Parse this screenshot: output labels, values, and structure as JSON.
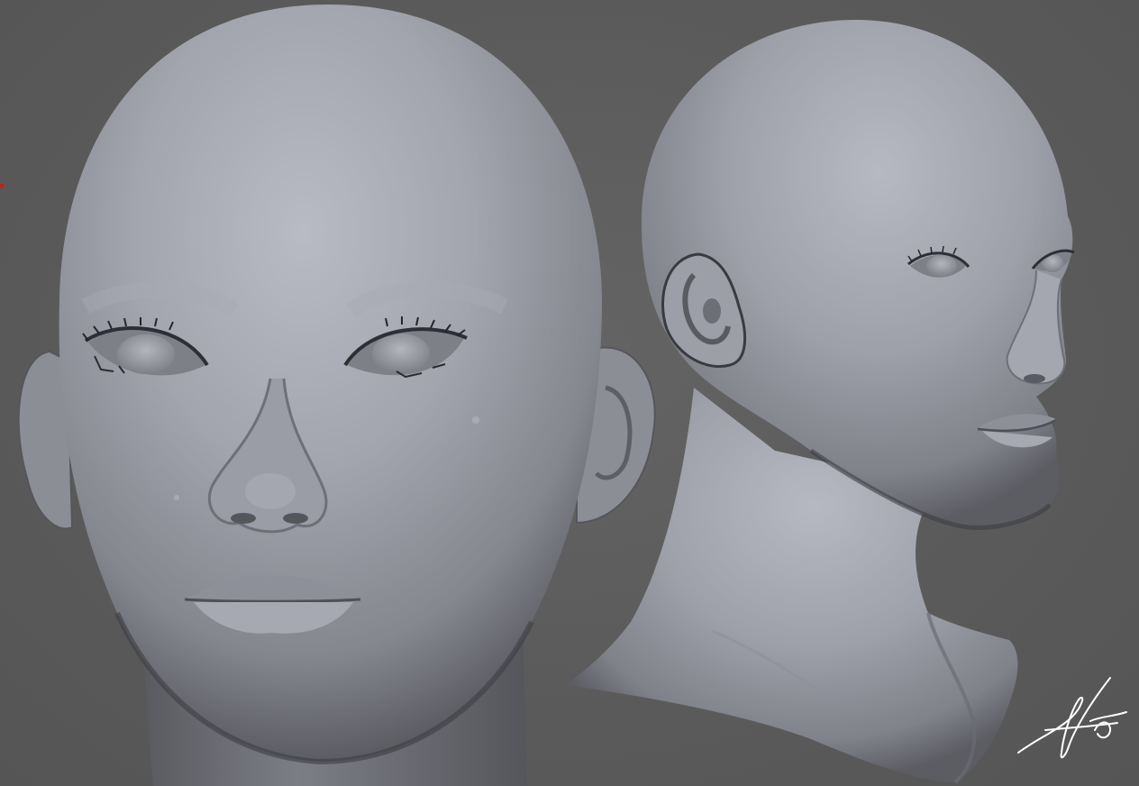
{
  "scene": {
    "background_color": "#5b5b5b",
    "material_color": "#9a9ca6",
    "views": [
      {
        "name": "front"
      },
      {
        "name": "three-quarter"
      }
    ]
  },
  "signature": {
    "color": "#ffffff",
    "text": "signature"
  },
  "marker": {
    "color": "#c02020"
  }
}
